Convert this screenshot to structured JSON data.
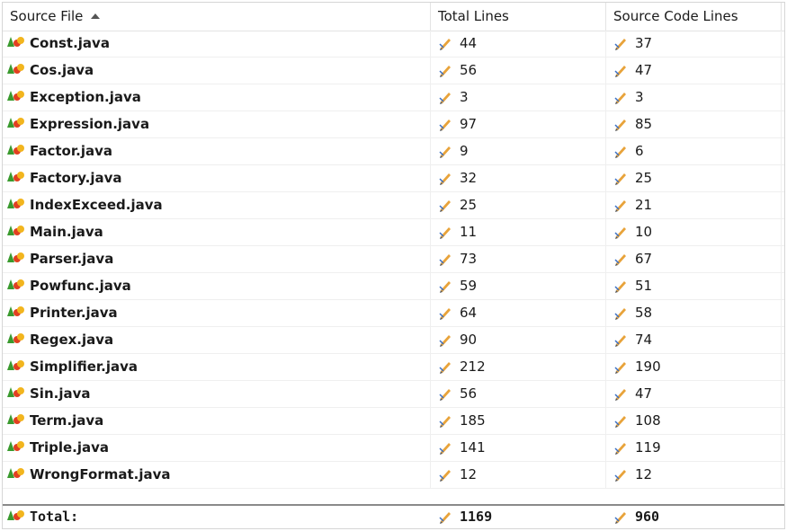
{
  "columns": [
    {
      "label": "Source File",
      "sort": "ascending"
    },
    {
      "label": "Total Lines"
    },
    {
      "label": "Source Code Lines"
    }
  ],
  "rows": [
    {
      "file": "Const.java",
      "total": "44",
      "code": "37"
    },
    {
      "file": "Cos.java",
      "total": "56",
      "code": "47"
    },
    {
      "file": "Exception.java",
      "total": "3",
      "code": "3"
    },
    {
      "file": "Expression.java",
      "total": "97",
      "code": "85"
    },
    {
      "file": "Factor.java",
      "total": "9",
      "code": "6"
    },
    {
      "file": "Factory.java",
      "total": "32",
      "code": "25"
    },
    {
      "file": "IndexExceed.java",
      "total": "25",
      "code": "21"
    },
    {
      "file": "Main.java",
      "total": "11",
      "code": "10"
    },
    {
      "file": "Parser.java",
      "total": "73",
      "code": "67"
    },
    {
      "file": "Powfunc.java",
      "total": "59",
      "code": "51"
    },
    {
      "file": "Printer.java",
      "total": "64",
      "code": "58"
    },
    {
      "file": "Regex.java",
      "total": "90",
      "code": "74"
    },
    {
      "file": "Simplifier.java",
      "total": "212",
      "code": "190"
    },
    {
      "file": "Sin.java",
      "total": "56",
      "code": "47"
    },
    {
      "file": "Term.java",
      "total": "185",
      "code": "108"
    },
    {
      "file": "Triple.java",
      "total": "141",
      "code": "119"
    },
    {
      "file": "WrongFormat.java",
      "total": "12",
      "code": "12"
    }
  ],
  "total": {
    "label": "Total:",
    "total": "1169",
    "code": "960"
  },
  "icons": {
    "file": "java-source-file-icon",
    "metric": "pencil-ruler-icon",
    "sort": "sort-ascending-icon"
  }
}
